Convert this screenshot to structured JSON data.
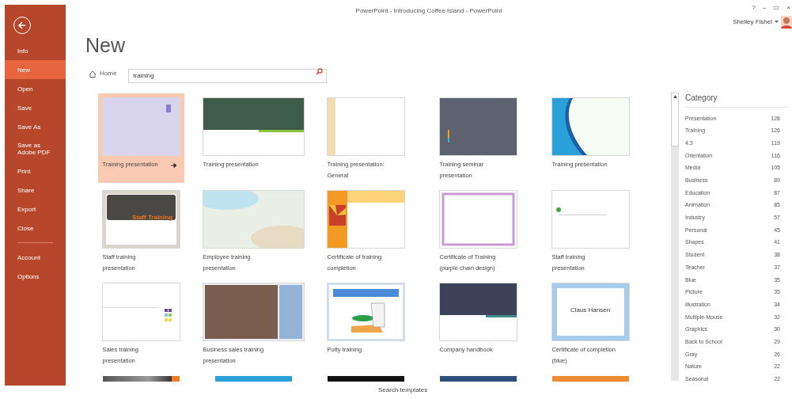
{
  "window": {
    "title": "PowerPoint - Introducing Coffee Island - PowerPoint",
    "controls": [
      "?",
      "–",
      "▭",
      "×"
    ]
  },
  "account": {
    "name": "Shelley Fishel"
  },
  "sidebar": {
    "items": [
      {
        "label": "Info",
        "selected": false,
        "divider_before": false
      },
      {
        "label": "New",
        "selected": true,
        "divider_before": false
      },
      {
        "label": "Open",
        "selected": false,
        "divider_before": false
      },
      {
        "label": "Save",
        "selected": false,
        "divider_before": false
      },
      {
        "label": "Save As",
        "selected": false,
        "divider_before": false
      },
      {
        "label": "Save as Adobe PDF",
        "selected": false,
        "divider_before": false
      },
      {
        "label": "Print",
        "selected": false,
        "divider_before": false
      },
      {
        "label": "Share",
        "selected": false,
        "divider_before": false
      },
      {
        "label": "Export",
        "selected": false,
        "divider_before": false
      },
      {
        "label": "Close",
        "selected": false,
        "divider_before": false
      },
      {
        "label": "Account",
        "selected": false,
        "divider_before": true
      },
      {
        "label": "Options",
        "selected": false,
        "divider_before": false
      }
    ]
  },
  "heading": "New",
  "breadcrumb": "Home",
  "search": {
    "value": "training"
  },
  "templates": [
    {
      "label": "Training presentation",
      "selected": true
    },
    {
      "label": "Training presentation",
      "selected": false
    },
    {
      "label": "Training presentation: General",
      "selected": false
    },
    {
      "label": "Training seminar presentation",
      "selected": false
    },
    {
      "label": "Training presentation",
      "selected": false
    },
    {
      "label": "Staff training presentation",
      "thumb_title": "Staff Training",
      "selected": false
    },
    {
      "label": "Employee training presentation",
      "selected": false
    },
    {
      "label": "Certificate of training completion",
      "selected": false
    },
    {
      "label": "Certificate of Training (purple chain design)",
      "selected": false
    },
    {
      "label": "Staff training presentation",
      "selected": false
    },
    {
      "label": "Sales training presentation",
      "selected": false
    },
    {
      "label": "Business sales training presentation",
      "selected": false
    },
    {
      "label": "Potty training",
      "selected": false
    },
    {
      "label": "Company handbook",
      "selected": false
    },
    {
      "label": "Certificate of completion (blue)",
      "thumb_title": "Claus Hansen",
      "selected": false
    }
  ],
  "footer": "Search templates",
  "category": {
    "title": "Category",
    "items": [
      {
        "name": "Presentation",
        "count": "128"
      },
      {
        "name": "Training",
        "count": "126"
      },
      {
        "name": "4:3",
        "count": "119"
      },
      {
        "name": "Orientation",
        "count": "116"
      },
      {
        "name": "Media",
        "count": "105"
      },
      {
        "name": "Business",
        "count": "89"
      },
      {
        "name": "Education",
        "count": "87"
      },
      {
        "name": "Animation",
        "count": "85"
      },
      {
        "name": "Industry",
        "count": "57"
      },
      {
        "name": "Personal",
        "count": "45"
      },
      {
        "name": "Shapes",
        "count": "41"
      },
      {
        "name": "Student",
        "count": "38"
      },
      {
        "name": "Teacher",
        "count": "37"
      },
      {
        "name": "Blue",
        "count": "35"
      },
      {
        "name": "Picture",
        "count": "35"
      },
      {
        "name": "Illustration",
        "count": "34"
      },
      {
        "name": "Multiple-Mouse",
        "count": "32"
      },
      {
        "name": "Graphics",
        "count": "30"
      },
      {
        "name": "Back to School",
        "count": "29"
      },
      {
        "name": "Gray",
        "count": "26"
      },
      {
        "name": "Nature",
        "count": "22"
      },
      {
        "name": "Seasonal",
        "count": "22"
      }
    ]
  }
}
